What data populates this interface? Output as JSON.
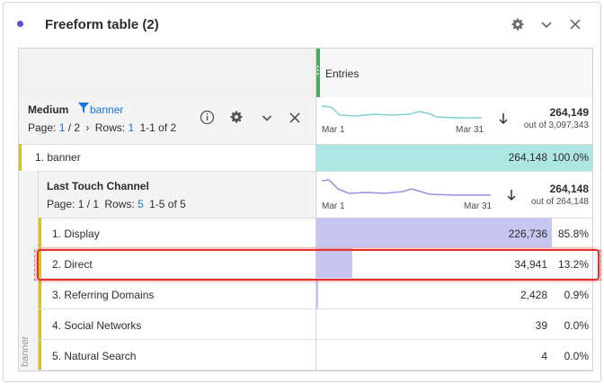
{
  "panel": {
    "title": "Freeform table (2)",
    "accent": "#5b4fd6"
  },
  "header": {
    "metric": "Entries",
    "metric_color": "#4cae5a"
  },
  "dimension": {
    "name": "Medium",
    "filter": "banner",
    "page_label": "Page:",
    "page_current": "1",
    "page_total": "/ 2",
    "rows_label": "Rows:",
    "rows_value": "1",
    "range": "1-1 of 2",
    "total": "264,149",
    "out_of": "out of 3,097,343",
    "spark_start": "Mar 1",
    "spark_end": "Mar 31"
  },
  "row1": {
    "label": "1. banner",
    "value": "264,148",
    "pct": "100.0%",
    "fraction": 1.0,
    "bar_color": "#aee6e4"
  },
  "subdimension": {
    "name": "Last Touch Channel",
    "page": "Page: 1 / 1",
    "rows_label": "Rows:",
    "rows_value": "5",
    "range": "1-5 of 5",
    "total": "264,148",
    "out_of": "out of 264,148",
    "spark_start": "Mar 1",
    "spark_end": "Mar 31",
    "side_label": "banner"
  },
  "subrows": [
    {
      "label": "1. Display",
      "value": "226,736",
      "pct": "85.8%",
      "fraction": 0.858
    },
    {
      "label": "2. Direct",
      "value": "34,941",
      "pct": "13.2%",
      "fraction": 0.132
    },
    {
      "label": "3. Referring Domains",
      "value": "2,428",
      "pct": "0.9%",
      "fraction": 0.009
    },
    {
      "label": "4. Social Networks",
      "value": "39",
      "pct": "0.0%",
      "fraction": 0.0
    },
    {
      "label": "5. Natural Search",
      "value": "4",
      "pct": "0.0%",
      "fraction": 0.0
    }
  ],
  "sub_bar_color": "#c6c6f1"
}
